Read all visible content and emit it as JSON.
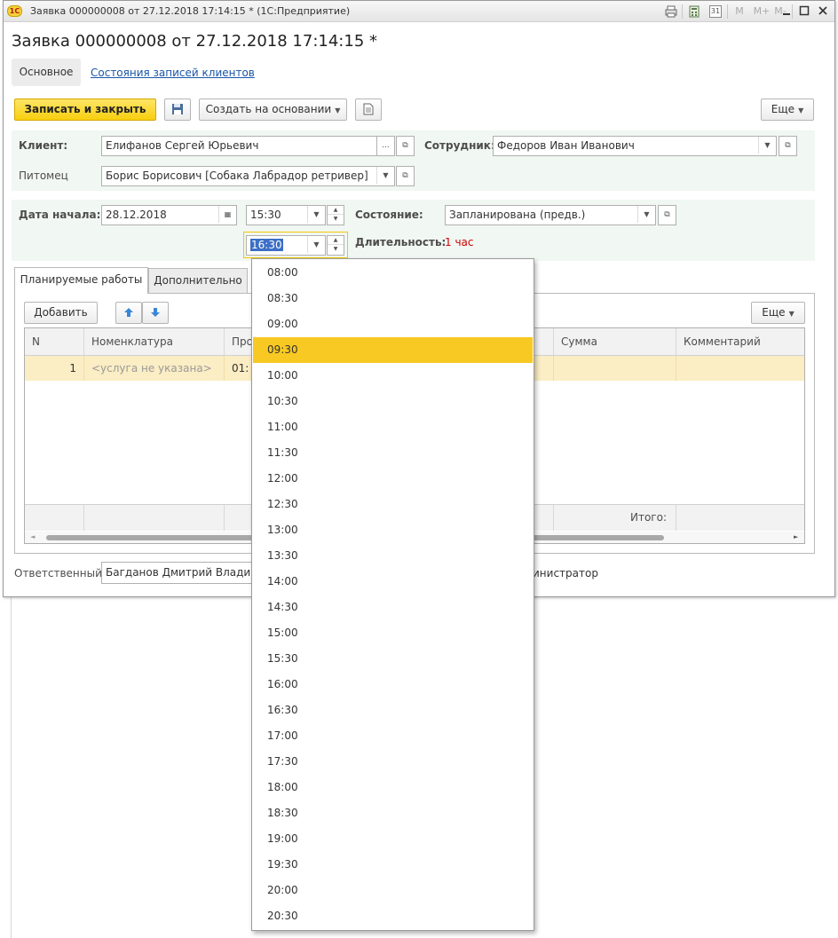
{
  "window": {
    "title": "Заявка 000000008 от 27.12.2018 17:14:15 * (1С:Предприятие)",
    "app_badge": "1С",
    "toolbar_icons": [
      "print-icon",
      "calculator-icon",
      "calendar-icon",
      "memory-m-icon",
      "memory-plus-icon",
      "memory-minus-icon",
      "minimize-icon",
      "maximize-icon",
      "close-icon"
    ],
    "toolbar_glyphs": {
      "m": "M",
      "mplus": "M+",
      "mminus": "M-",
      "cal": "31"
    }
  },
  "form": {
    "title": "Заявка 000000008 от 27.12.2018 17:14:15 *",
    "nav_tabs": [
      "Основное",
      "Состояния записей клиентов"
    ],
    "buttons": {
      "save_close": "Записать и закрыть",
      "create_based": "Создать на основании",
      "more": "Еще"
    },
    "fields": {
      "client_label": "Клиент:",
      "client_value": "Елифанов Сергей Юрьевич",
      "employee_label": "Сотрудник:",
      "employee_value": "Федоров Иван Иванович",
      "pet_label": "Питомец",
      "pet_value": "Борис Борисович [Собака Лабрадор  ретривер]",
      "start_label": "Дата начала:",
      "start_date": "28.12.2018",
      "start_time": "15:30",
      "end_time": "16:30",
      "state_label": "Состояние:",
      "state_value": "Запланирована (предв.)",
      "duration_label": "Длительность:",
      "duration_value": "1 час",
      "responsible_label": "Ответственный:",
      "responsible_value": "Багданов Дмитрий Владим",
      "responsible_suffix": "инистратор"
    },
    "page_tabs": [
      "Планируемые работы",
      "Дополнительно"
    ],
    "table_toolbar": {
      "add": "Добавить",
      "more": "Еще"
    },
    "table": {
      "headers": [
        "N",
        "Номенклатура",
        "Про",
        "",
        "Сумма",
        "Комментарий"
      ],
      "row": {
        "n": "1",
        "item": "<услуга не указана>",
        "time": "01:"
      },
      "footer_total": "Итого:"
    }
  },
  "time_dropdown": {
    "selected": "09:30",
    "options": [
      "08:00",
      "08:30",
      "09:00",
      "09:30",
      "10:00",
      "10:30",
      "11:00",
      "11:30",
      "12:00",
      "12:30",
      "13:00",
      "13:30",
      "14:00",
      "14:30",
      "15:00",
      "15:30",
      "16:00",
      "16:30",
      "17:00",
      "17:30",
      "18:00",
      "18:30",
      "19:00",
      "19:30",
      "20:00",
      "20:30"
    ]
  },
  "colors": {
    "accent_yellow": "#f8c922",
    "link": "#1a56a8",
    "warning_red": "#d40000"
  }
}
